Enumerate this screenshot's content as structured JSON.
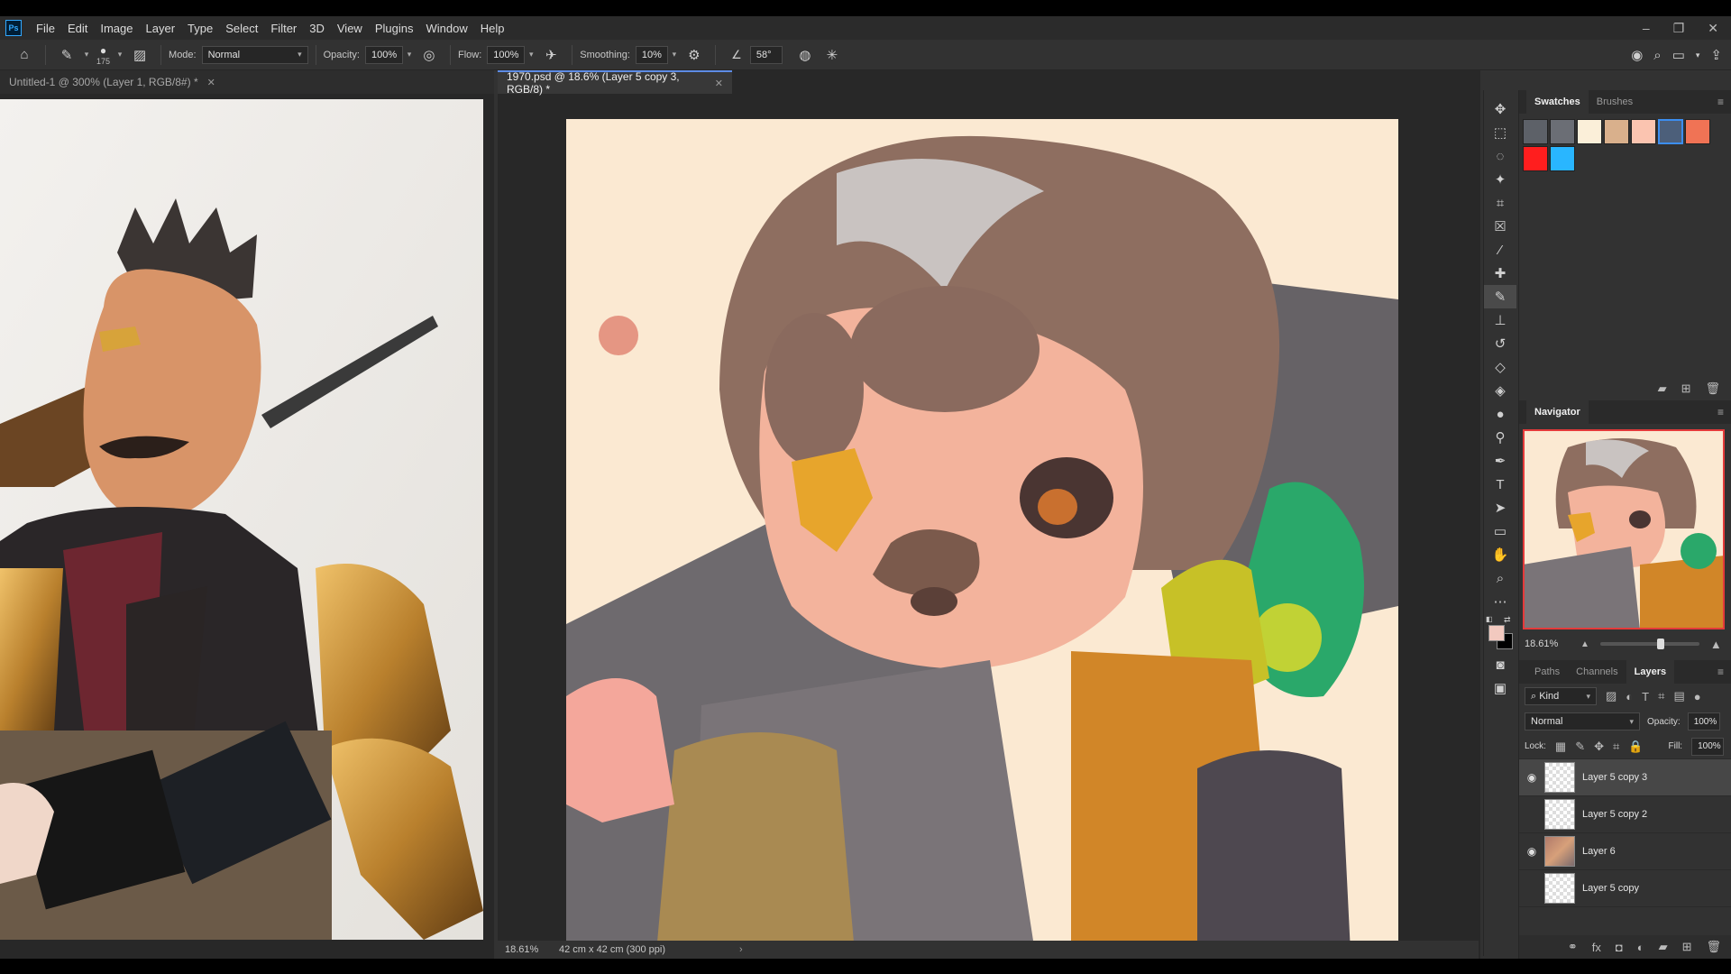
{
  "menu": {
    "logo": "Ps",
    "items": [
      "File",
      "Edit",
      "Image",
      "Layer",
      "Type",
      "Select",
      "Filter",
      "3D",
      "View",
      "Plugins",
      "Window",
      "Help"
    ]
  },
  "window_controls": {
    "minimize": "–",
    "restore": "❐",
    "close": "✕"
  },
  "options_bar": {
    "brush_size": "175",
    "mode_label": "Mode:",
    "mode_value": "Normal",
    "opacity_label": "Opacity:",
    "opacity_value": "100%",
    "flow_label": "Flow:",
    "flow_value": "100%",
    "smoothing_label": "Smoothing:",
    "smoothing_value": "10%",
    "angle_value": "58°"
  },
  "documents": [
    {
      "tab_title": "Untitled-1 @ 300% (Layer 1, RGB/8#) *",
      "active": false
    },
    {
      "tab_title": "1970.psd @ 18.6% (Layer 5 copy 3, RGB/8) *",
      "active": true,
      "zoom": "18.61%",
      "doc_size": "42 cm x 42 cm (300 ppi)"
    }
  ],
  "swatches_panel": {
    "tabs": [
      "Swatches",
      "Brushes"
    ],
    "active_tab": "Swatches",
    "colors": [
      "#5d6168",
      "#6b6e75",
      "#fbefd9",
      "#d9b08c",
      "#fbc4b0",
      "#4c5f7a",
      "#f07355",
      "#ff1e1e",
      "#29b6ff"
    ]
  },
  "navigator": {
    "title": "Navigator",
    "zoom": "18.61%",
    "zoom_fraction": 0.62
  },
  "layers_panel": {
    "tabs": [
      "Paths",
      "Channels",
      "Layers"
    ],
    "active_tab": "Layers",
    "filter_label": "Kind",
    "blend_mode": "Normal",
    "opacity_label": "Opacity:",
    "opacity_value": "100%",
    "lock_label": "Lock:",
    "fill_label": "Fill:",
    "fill_value": "100%",
    "layers": [
      {
        "name": "Layer 5 copy 3",
        "visible": true,
        "selected": true
      },
      {
        "name": "Layer 5 copy 2",
        "visible": false,
        "selected": false
      },
      {
        "name": "Layer 6",
        "visible": true,
        "selected": false
      },
      {
        "name": "Layer 5 copy",
        "visible": false,
        "selected": false
      }
    ]
  },
  "colors": {
    "foreground": "#f2c9bf",
    "background": "#000000",
    "canvas_bg": "#fbe9d2"
  }
}
